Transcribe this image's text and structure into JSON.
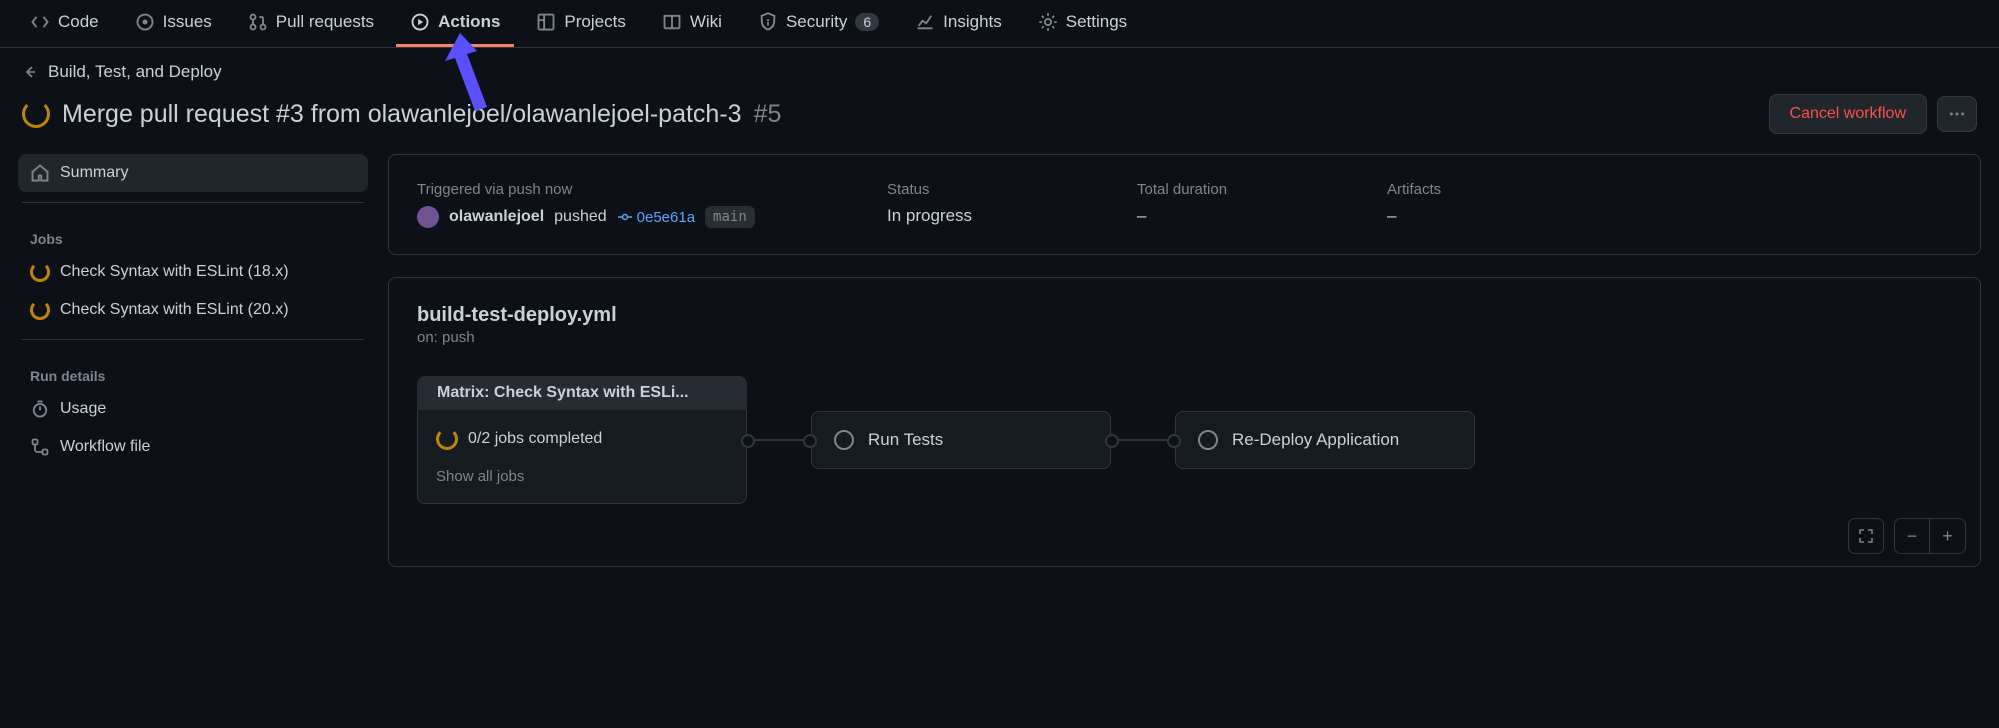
{
  "nav": {
    "code": "Code",
    "issues": "Issues",
    "pulls": "Pull requests",
    "actions": "Actions",
    "projects": "Projects",
    "wiki": "Wiki",
    "security": "Security",
    "security_count": "6",
    "insights": "Insights",
    "settings": "Settings"
  },
  "breadcrumb": {
    "workflow": "Build, Test, and Deploy"
  },
  "header": {
    "title": "Merge pull request #3 from olawanlejoel/olawanlejoel-patch-3",
    "run_number": "#5",
    "cancel": "Cancel workflow"
  },
  "sidebar": {
    "summary": "Summary",
    "jobs_label": "Jobs",
    "jobs": [
      {
        "label": "Check Syntax with ESLint (18.x)"
      },
      {
        "label": "Check Syntax with ESLint (20.x)"
      }
    ],
    "run_details_label": "Run details",
    "usage": "Usage",
    "workflow_file": "Workflow file"
  },
  "summary": {
    "trigger_label": "Triggered via push now",
    "user": "olawanlejoel",
    "pushed": "pushed",
    "commit": "0e5e61a",
    "branch": "main",
    "status_label": "Status",
    "status": "In progress",
    "duration_label": "Total duration",
    "duration": "–",
    "artifacts_label": "Artifacts",
    "artifacts": "–"
  },
  "workflow": {
    "file": "build-test-deploy.yml",
    "on": "on: push",
    "matrix_title": "Matrix: Check Syntax with ESLi...",
    "matrix_progress": "0/2 jobs completed",
    "show_all": "Show all jobs",
    "stages": [
      {
        "label": "Run Tests"
      },
      {
        "label": "Re-Deploy Application"
      }
    ]
  }
}
